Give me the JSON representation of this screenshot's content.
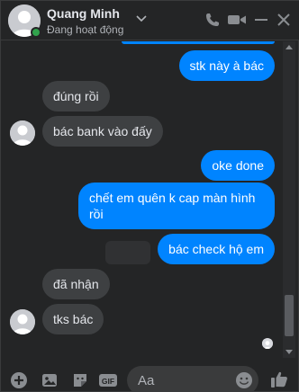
{
  "header": {
    "name": "Quang Minh",
    "status": "Đang hoạt động"
  },
  "messages": [
    {
      "id": "m1",
      "direction": "out",
      "text": "stk này à bác"
    },
    {
      "id": "m2",
      "direction": "in",
      "text": "đúng rồi"
    },
    {
      "id": "m3",
      "direction": "in",
      "text": "bác bank vào đấy"
    },
    {
      "id": "m4",
      "direction": "out",
      "text": "oke done"
    },
    {
      "id": "m5",
      "direction": "out",
      "text": "chết em quên k cap màn hình rồi"
    },
    {
      "id": "m6",
      "direction": "out",
      "text": "bác check hộ em"
    },
    {
      "id": "m7",
      "direction": "in",
      "text": "đã nhận"
    },
    {
      "id": "m8",
      "direction": "in",
      "text": "tks bác"
    }
  ],
  "composer": {
    "placeholder": "Aa"
  },
  "colors": {
    "background": "#242526",
    "outgoing_bubble": "#0084ff",
    "incoming_bubble": "#3e4042",
    "accent_icon": "#0a7cff",
    "online": "#31a24c"
  },
  "icons": {
    "header": [
      "phone-icon",
      "video-camera-icon",
      "minimize-icon",
      "close-icon",
      "chevron-down-icon"
    ],
    "composer": [
      "plus-circle-icon",
      "image-icon",
      "sticker-icon",
      "gif-icon",
      "emoji-icon",
      "thumbs-up-icon"
    ]
  }
}
